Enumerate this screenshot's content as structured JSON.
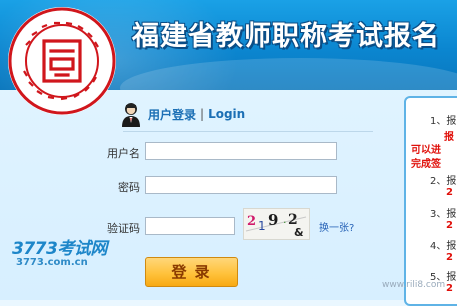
{
  "header": {
    "title": "福建省教师职称考试报名",
    "logo_colors": {
      "seal": "#d0161c",
      "bg": "#1aa1e6"
    }
  },
  "login": {
    "heading_cn": "用户登录",
    "heading_sep": "|",
    "heading_en": "Login",
    "username_label": "用户名",
    "password_label": "密码",
    "captcha_label": "验证码",
    "captcha_text": "2 9 2 &",
    "refresh_label": "换一张?",
    "submit_label": "登录"
  },
  "brand": {
    "logo_text": "3773考试网",
    "url": "3773.com.cn"
  },
  "notice": {
    "lines": [
      {
        "text": "1、报",
        "style": "blk"
      },
      {
        "text": "报",
        "style": "red"
      },
      {
        "text": "可以进",
        "style": "red"
      },
      {
        "text": "完成签",
        "style": "red"
      },
      {
        "text": "2、报",
        "style": "blk"
      },
      {
        "text": "2",
        "style": "red"
      },
      {
        "text": "3、报",
        "style": "blk"
      },
      {
        "text": "2",
        "style": "red"
      },
      {
        "text": "4、报",
        "style": "blk"
      },
      {
        "text": "2",
        "style": "red"
      },
      {
        "text": "5、报",
        "style": "blk"
      },
      {
        "text": "2",
        "style": "red"
      }
    ]
  },
  "watermark": "www.rili8.com"
}
